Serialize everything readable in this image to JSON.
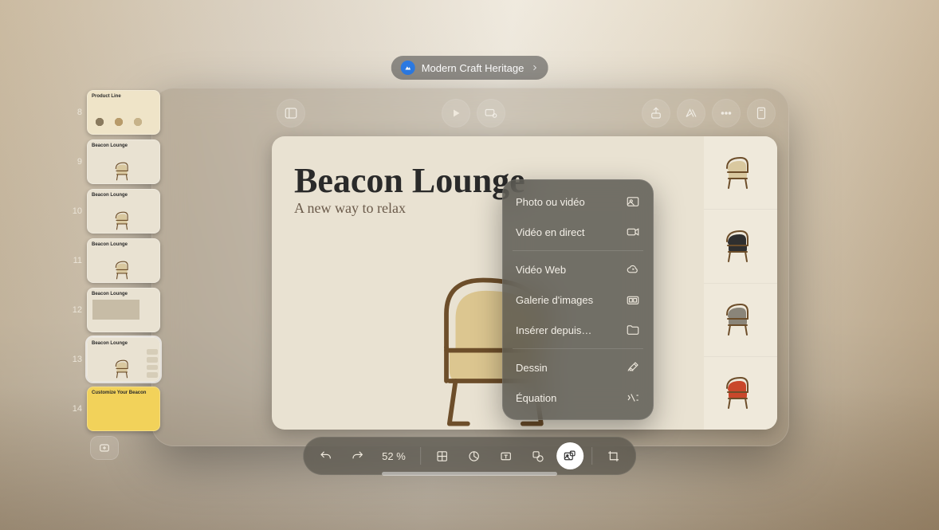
{
  "header": {
    "doc_title": "Modern Craft Heritage"
  },
  "slide": {
    "title": "Beacon Lounge",
    "subtitle": "A new way to relax"
  },
  "rail": {
    "start_number": 8,
    "thumbs": [
      {
        "n": 8,
        "title": "Product Line",
        "variant": "product"
      },
      {
        "n": 9,
        "title": "Beacon Lounge",
        "variant": "chair"
      },
      {
        "n": 10,
        "title": "Beacon Lounge",
        "variant": "chair"
      },
      {
        "n": 11,
        "title": "Beacon Lounge",
        "variant": "chair"
      },
      {
        "n": 12,
        "title": "Beacon Lounge",
        "variant": "grid"
      },
      {
        "n": 13,
        "title": "Beacon Lounge",
        "variant": "chair",
        "selected": true
      },
      {
        "n": 14,
        "title": "Customize Your Beacon",
        "variant": "custom"
      }
    ]
  },
  "gallery_colors": [
    "#d9c89f",
    "#2f2f2f",
    "#8a8579",
    "#c9472b"
  ],
  "menu": {
    "groups": [
      [
        {
          "label": "Photo ou vidéo",
          "icon": "photo"
        },
        {
          "label": "Vidéo en direct",
          "icon": "camera"
        }
      ],
      [
        {
          "label": "Vidéo Web",
          "icon": "cloud"
        },
        {
          "label": "Galerie d'images",
          "icon": "gallery"
        },
        {
          "label": "Insérer depuis…",
          "icon": "folder"
        }
      ],
      [
        {
          "label": "Dessin",
          "icon": "draw"
        },
        {
          "label": "Équation",
          "icon": "equation"
        }
      ]
    ]
  },
  "bottombar": {
    "zoom_label": "52 %"
  }
}
